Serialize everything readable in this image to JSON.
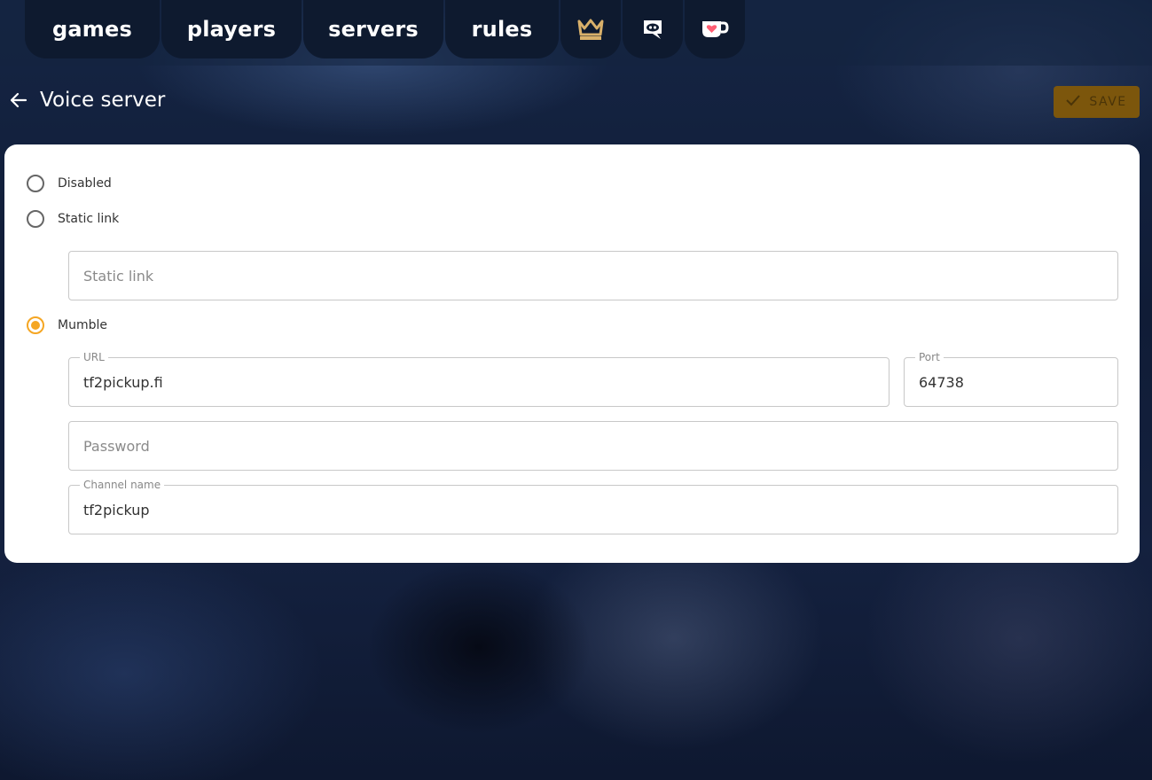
{
  "nav": {
    "items": [
      "games",
      "players",
      "servers",
      "rules"
    ],
    "icons": [
      "crown-icon",
      "discord-icon",
      "ko-fi-icon"
    ],
    "crown_color": "#d8b06a"
  },
  "header": {
    "title": "Voice server",
    "save_label": "SAVE"
  },
  "voice": {
    "options": [
      {
        "label": "Disabled",
        "selected": false
      },
      {
        "label": "Static link",
        "selected": false
      },
      {
        "label": "Mumble",
        "selected": true
      }
    ],
    "static_link": {
      "placeholder": "Static link",
      "value": ""
    },
    "mumble": {
      "url_label": "URL",
      "url": "tf2pickup.fi",
      "port_label": "Port",
      "port": "64738",
      "password_placeholder": "Password",
      "channel_label": "Channel name",
      "channel": "tf2pickup"
    }
  },
  "colors": {
    "accent": "#f5a623",
    "save_bg": "#7c560c",
    "nav_bg": "#0e1a2f"
  }
}
